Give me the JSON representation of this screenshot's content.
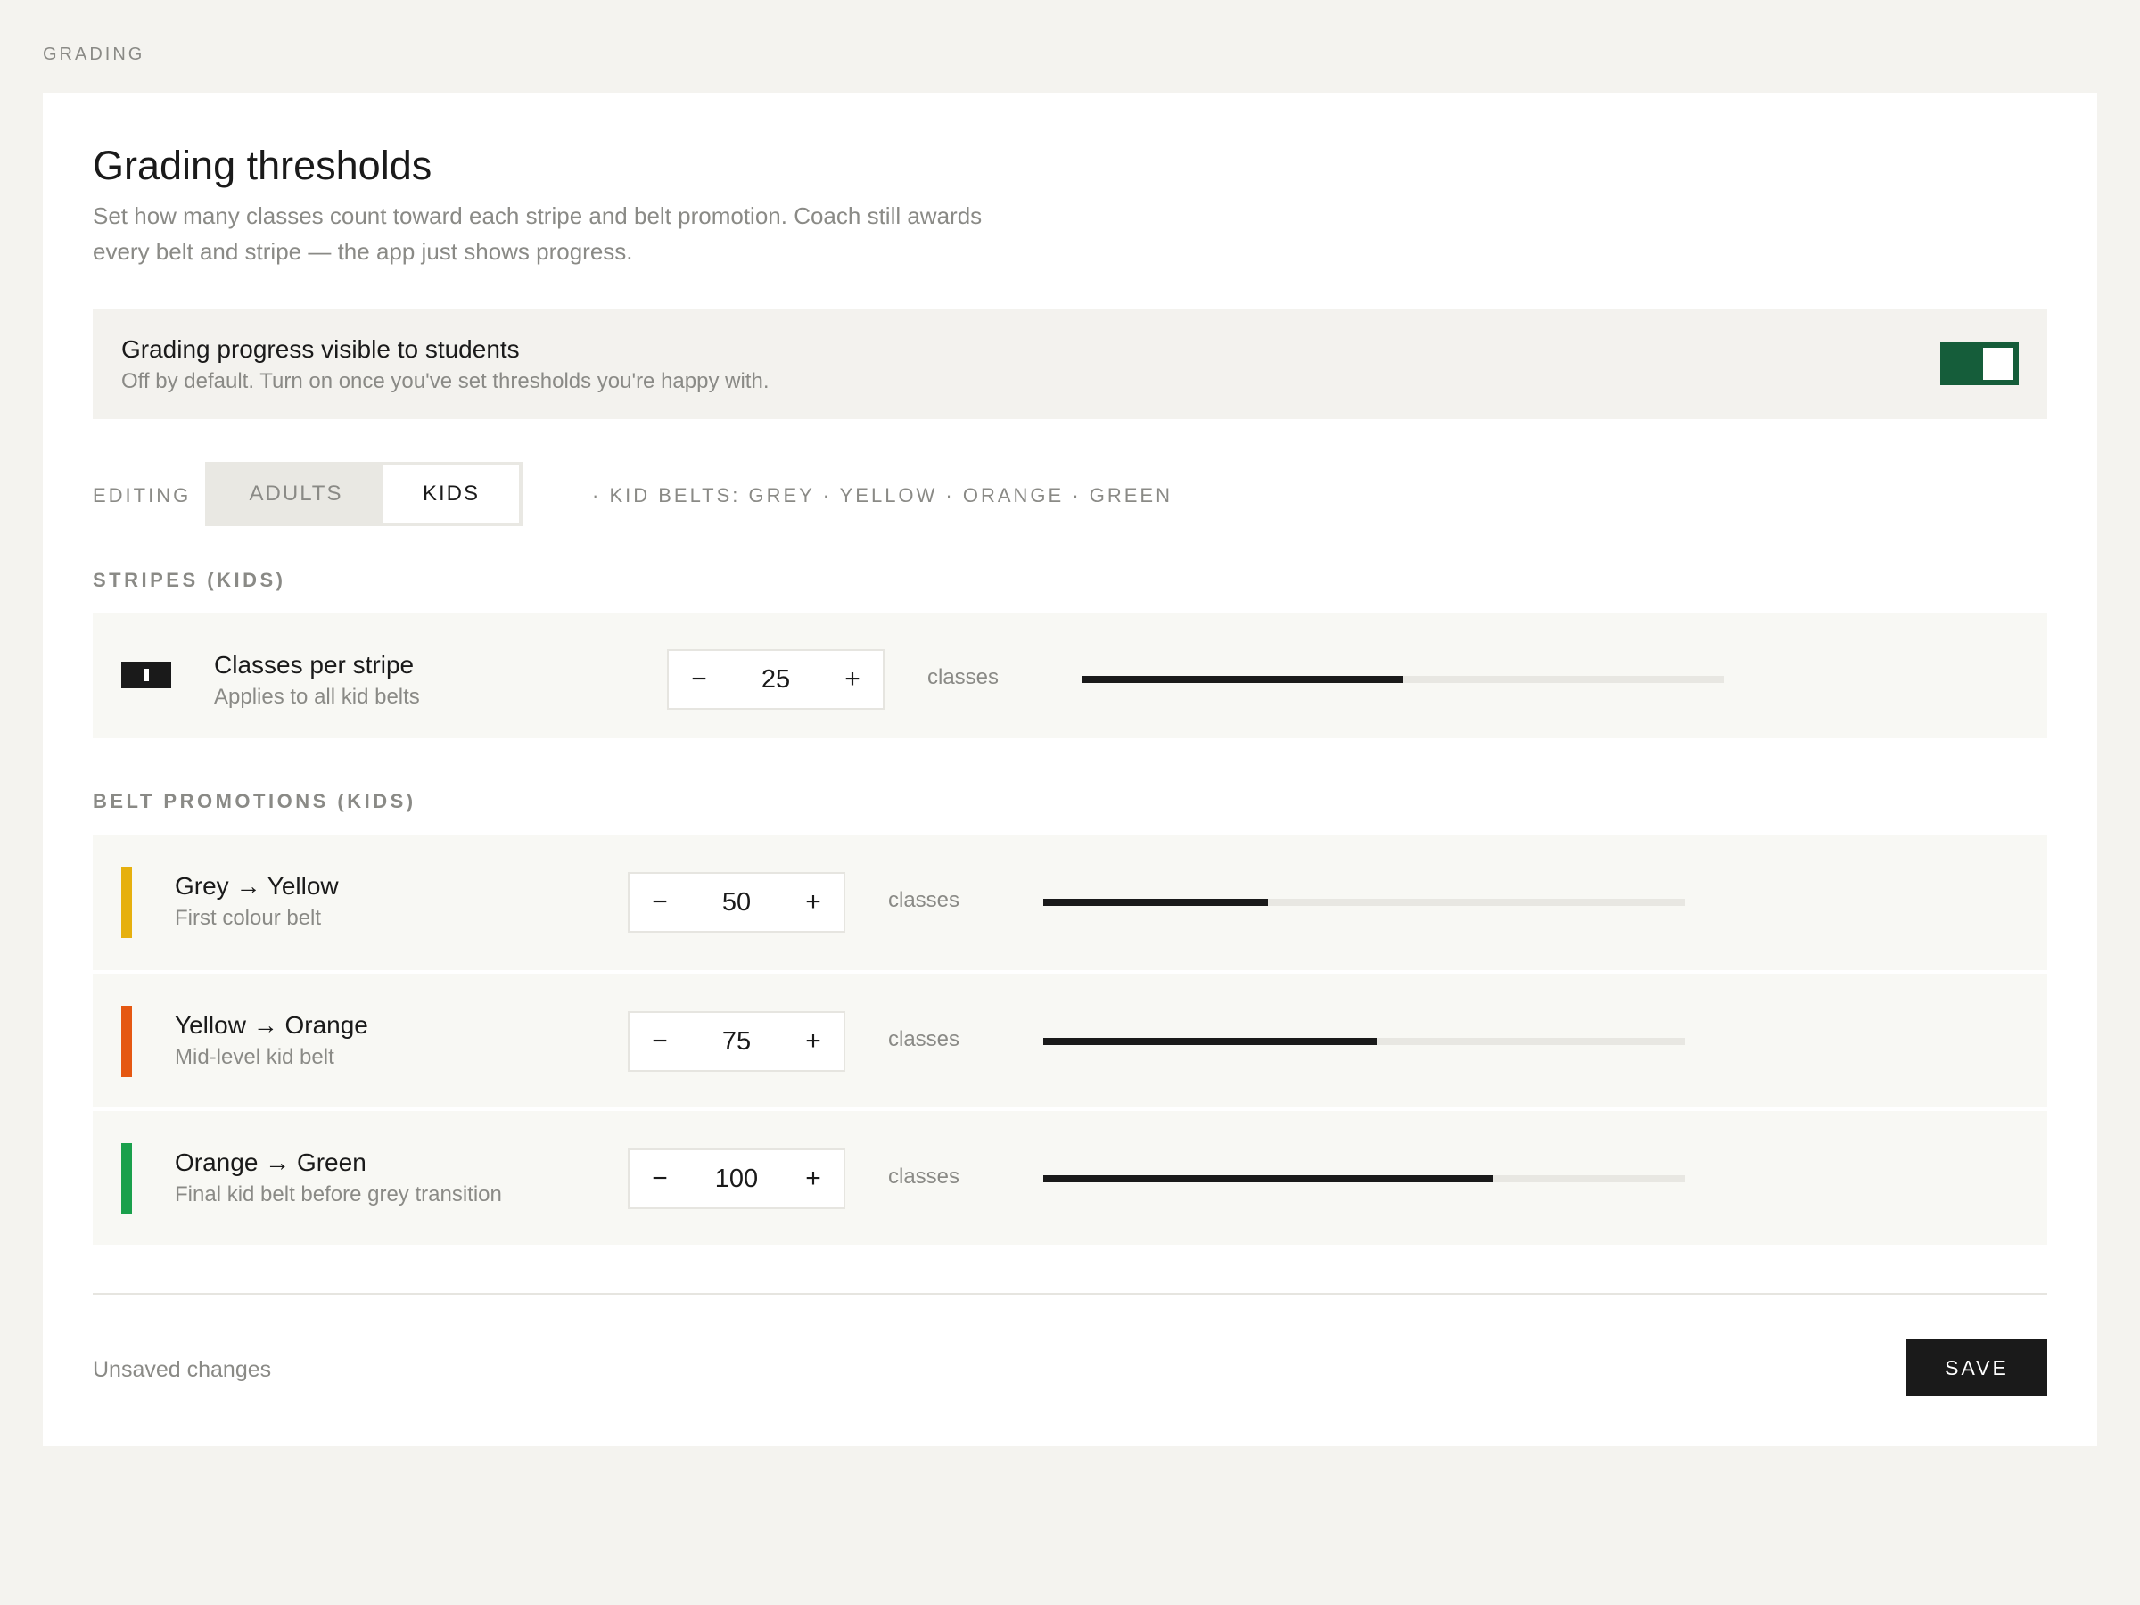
{
  "breadcrumb": "GRADING",
  "header": {
    "title": "Grading thresholds",
    "description": "Set how many classes count toward each stripe and belt promotion. Coach still awards every belt and stripe — the app just shows progress."
  },
  "visibility": {
    "title": "Grading progress visible to students",
    "subtitle": "Off by default. Turn on once you've set thresholds you're happy with.",
    "enabled": true
  },
  "editing": {
    "label": "EDITING",
    "tabs": [
      {
        "label": "ADULTS",
        "active": false
      },
      {
        "label": "KIDS",
        "active": true
      }
    ],
    "belt_note": "· KID BELTS: GREY · YELLOW · ORANGE · GREEN"
  },
  "stripes": {
    "section_label": "STRIPES (KIDS)",
    "title": "Classes per stripe",
    "subtitle": "Applies to all kid belts",
    "value": "25",
    "unit": "classes",
    "progress": 0.5
  },
  "promotions": {
    "section_label": "BELT PROMOTIONS (KIDS)",
    "items": [
      {
        "title": "Grey → Yellow",
        "subtitle": "First colour belt",
        "value": "50",
        "unit": "classes",
        "color": "#e6b00e",
        "progress": 0.35
      },
      {
        "title": "Yellow → Orange",
        "subtitle": "Mid-level kid belt",
        "value": "75",
        "unit": "classes",
        "color": "#e55812",
        "progress": 0.52
      },
      {
        "title": "Orange → Green",
        "subtitle": "Final kid belt before grey transition",
        "value": "100",
        "unit": "classes",
        "color": "#1aa04c",
        "progress": 0.7
      }
    ]
  },
  "stepper": {
    "minus": "−",
    "plus": "+"
  },
  "footer": {
    "status": "Unsaved changes",
    "save_label": "SAVE"
  },
  "colors": {
    "accent_toggle": "#155d3a",
    "primary": "#1a1a1a"
  }
}
